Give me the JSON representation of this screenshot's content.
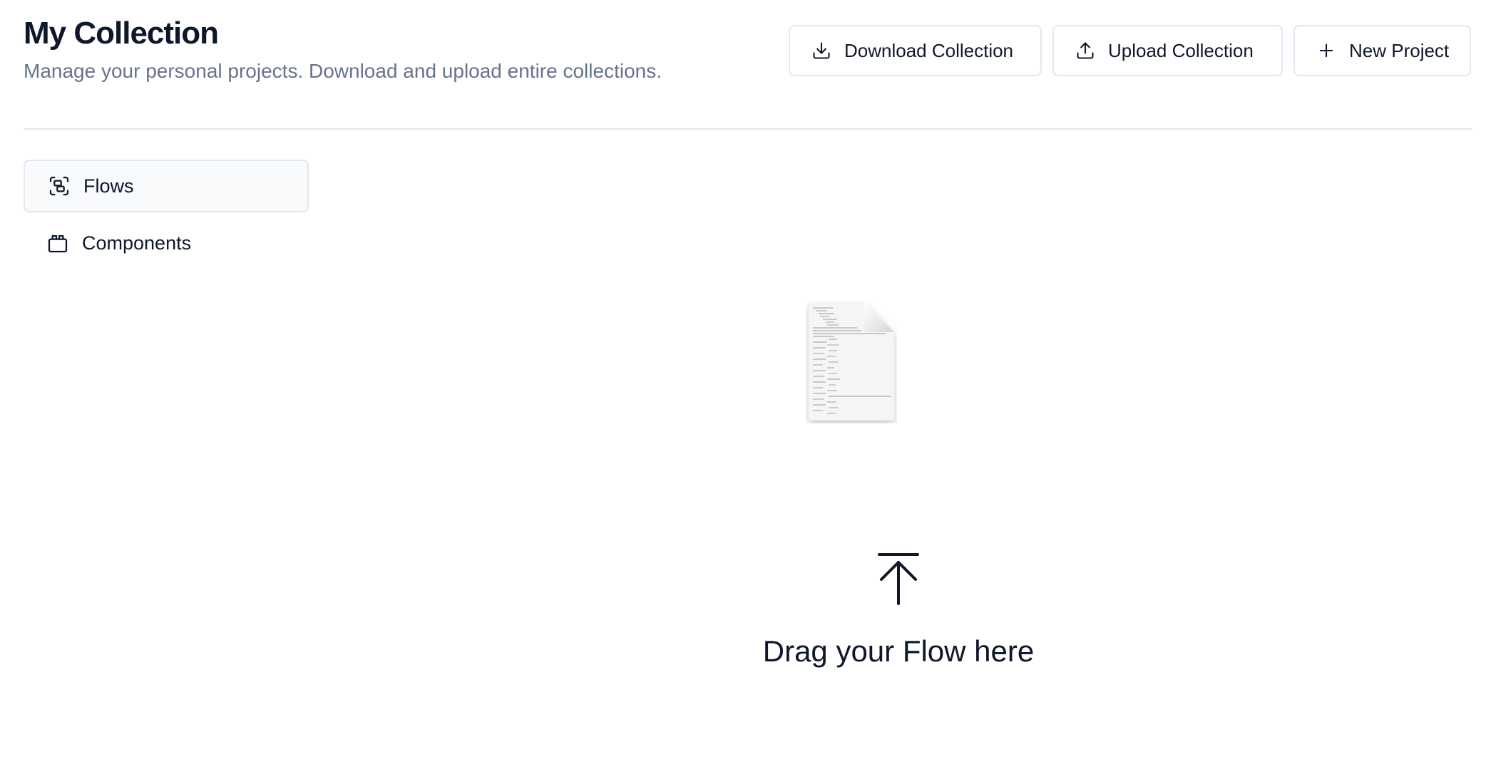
{
  "header": {
    "title": "My Collection",
    "subtitle": "Manage your personal projects. Download and upload entire collections."
  },
  "actions": {
    "download_label": "Download Collection",
    "download_icon": "download-icon",
    "upload_label": "Upload Collection",
    "upload_icon": "upload-icon",
    "new_label": "New Project",
    "new_icon": "plus-icon"
  },
  "sidebar": {
    "items": [
      {
        "label": "Flows",
        "icon": "flows-icon",
        "active": true
      },
      {
        "label": "Components",
        "icon": "components-icon",
        "active": false
      }
    ]
  },
  "dropzone": {
    "file_icon": "file-document-icon",
    "arrow_icon": "upload-arrow-icon",
    "text": "Drag your Flow here"
  },
  "colors": {
    "text": "#0f172a",
    "muted": "#64748b",
    "border": "#e2e8f0",
    "active_bg": "#f8fafc"
  }
}
